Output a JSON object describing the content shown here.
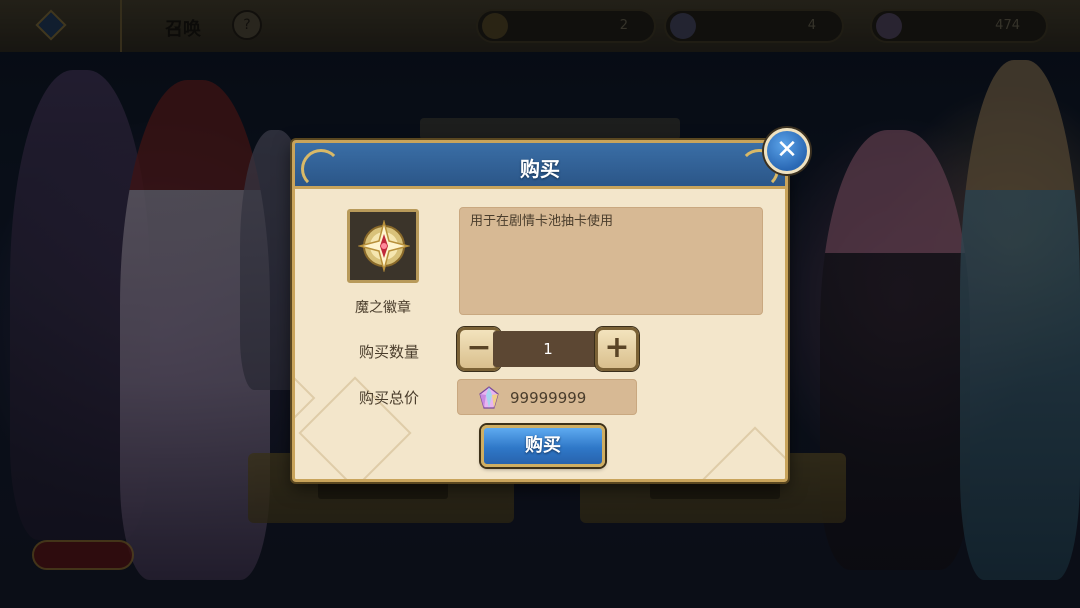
{
  "top_bar": {
    "title": "召唤",
    "help_label": "?",
    "resources": [
      {
        "icon": "medal-icon",
        "amount": "2"
      },
      {
        "icon": "star-coin-icon",
        "amount": "4"
      },
      {
        "icon": "crystal-icon",
        "amount": "474"
      }
    ]
  },
  "dialog": {
    "title": "购买",
    "close_label": "✕",
    "item": {
      "name": "魔之徽章",
      "description": "用于在剧情卡池抽卡使用"
    },
    "quantity": {
      "label": "购买数量",
      "value": "1",
      "minus_label": "−",
      "plus_label": "+"
    },
    "total": {
      "label": "购买总价",
      "currency_icon": "crystal-icon",
      "value": "99999999"
    },
    "buy_button_label": "购买"
  },
  "colors": {
    "header_blue": "#2f64a0",
    "gold_border": "#c9a45b",
    "panel_bg": "#f3e6cb",
    "button_blue": "#2f78c8"
  }
}
